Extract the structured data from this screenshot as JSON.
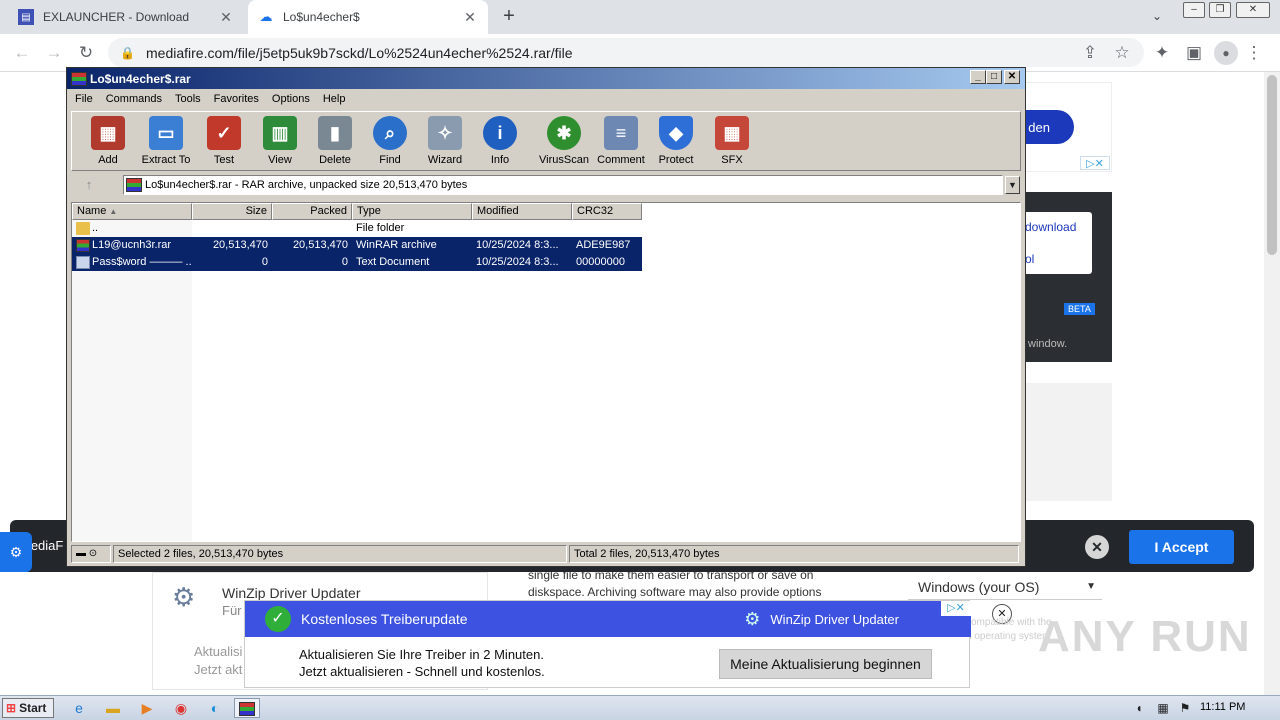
{
  "browser": {
    "tabs": [
      {
        "title": "EXLAUNCHER - Download",
        "active": false
      },
      {
        "title": "Lo$un4echer$",
        "active": true
      }
    ],
    "new_tab_label": "+",
    "url": "mediafire.com/file/j5etp5uk9b7sckd/Lo%2524un4echer%2524.rar/file"
  },
  "page": {
    "pill_text": "den",
    "download_link": "download",
    "tool_link": "ol",
    "beta_badge": "BETA",
    "window_text": "window.",
    "consent_prefix": "MediaF",
    "accept_label": "I Accept",
    "winzip_title": "WinZip Driver Updater",
    "winzip_sub": "Für",
    "left_text_1": "Aktualisi",
    "left_text_2": "Jetzt akt",
    "mid_text_1": "single file to make them easier to transport or save on",
    "mid_text_2": "diskspace. Archiving software may also provide options",
    "os_select": "Windows (your OS)",
    "faded_1": "compatible with the",
    "faded_2": "d operating system"
  },
  "winrar": {
    "title": "Lo$un4echer$.rar",
    "menu": [
      "File",
      "Commands",
      "Tools",
      "Favorites",
      "Options",
      "Help"
    ],
    "toolbar": [
      {
        "label": "Add",
        "icon": "add-archive-icon",
        "color": "#b03a2e"
      },
      {
        "label": "Extract To",
        "icon": "folder-extract-icon",
        "color": "#3b7fd4"
      },
      {
        "label": "Test",
        "icon": "test-checklist-icon",
        "color": "#c0392b"
      },
      {
        "label": "View",
        "icon": "book-view-icon",
        "color": "#2e8b3a"
      },
      {
        "label": "Delete",
        "icon": "trash-icon",
        "color": "#7a8894"
      },
      {
        "label": "Find",
        "icon": "magnifier-icon",
        "color": "#2a6fc9"
      },
      {
        "label": "Wizard",
        "icon": "magic-wand-icon",
        "color": "#8a9bb0"
      },
      {
        "label": "Info",
        "icon": "info-icon",
        "color": "#1e5fbf"
      },
      {
        "label": "VirusScan",
        "icon": "bug-scan-icon",
        "color": "#2f8f2f"
      },
      {
        "label": "Comment",
        "icon": "comment-icon",
        "color": "#6d89b3"
      },
      {
        "label": "Protect",
        "icon": "shield-icon",
        "color": "#2d6fd6"
      },
      {
        "label": "SFX",
        "icon": "sfx-box-icon",
        "color": "#c4473a"
      }
    ],
    "path": "Lo$un4echer$.rar - RAR archive, unpacked size 20,513,470 bytes",
    "columns": [
      "Name",
      "Size",
      "Packed",
      "Type",
      "Modified",
      "CRC32"
    ],
    "rows": [
      {
        "name": "..",
        "size": "",
        "packed": "",
        "type": "File folder",
        "modified": "",
        "crc": "",
        "selected": false,
        "icon": "folder-icon"
      },
      {
        "name": "L19@ucnh3r.rar",
        "size": "20,513,470",
        "packed": "20,513,470",
        "type": "WinRAR archive",
        "modified": "10/25/2024 8:3...",
        "crc": "ADE9E987",
        "selected": true,
        "icon": "rar-file-icon"
      },
      {
        "name": "Pass$word ——— ...",
        "size": "0",
        "packed": "0",
        "type": "Text Document",
        "modified": "10/25/2024 8:3...",
        "crc": "00000000",
        "selected": true,
        "icon": "text-file-icon"
      }
    ],
    "status_left": "Selected 2 files, 20,513,470 bytes",
    "status_right": "Total 2 files, 20,513,470 bytes"
  },
  "ad": {
    "headline": "Kostenloses Treiberupdate",
    "brand": "WinZip Driver Updater",
    "line1": "Aktualisieren Sie Ihre Treiber in 2 Minuten.",
    "line2": "Jetzt aktualisieren - Schnell und kostenlos.",
    "button": "Meine Aktualisierung beginnen"
  },
  "taskbar": {
    "start_label": "Start",
    "clock": "11:11 PM"
  },
  "watermark": "ANY RUN"
}
